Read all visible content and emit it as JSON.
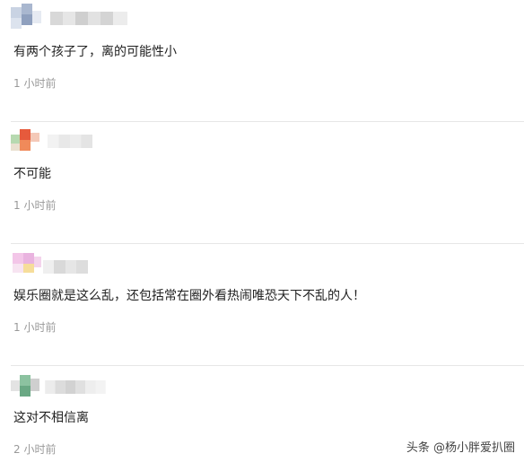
{
  "comments": [
    {
      "username": "",
      "text": "有两个孩子了，离的可能性小",
      "time": "1 小时前"
    },
    {
      "username": "",
      "text": "不可能",
      "time": "1 小时前"
    },
    {
      "username": "",
      "text": "娱乐圈就是这么乱，还包括常在圈外看热闹唯恐天下不乱的人！",
      "time": "1 小时前"
    },
    {
      "username": "",
      "text": "这对不相信离",
      "time": "2 小时前"
    }
  ],
  "watermark": "头条 @杨小胖爱扒圈",
  "colors": {
    "divider": "#e6e6e6",
    "time_text": "#999999",
    "body_text": "#222222"
  }
}
